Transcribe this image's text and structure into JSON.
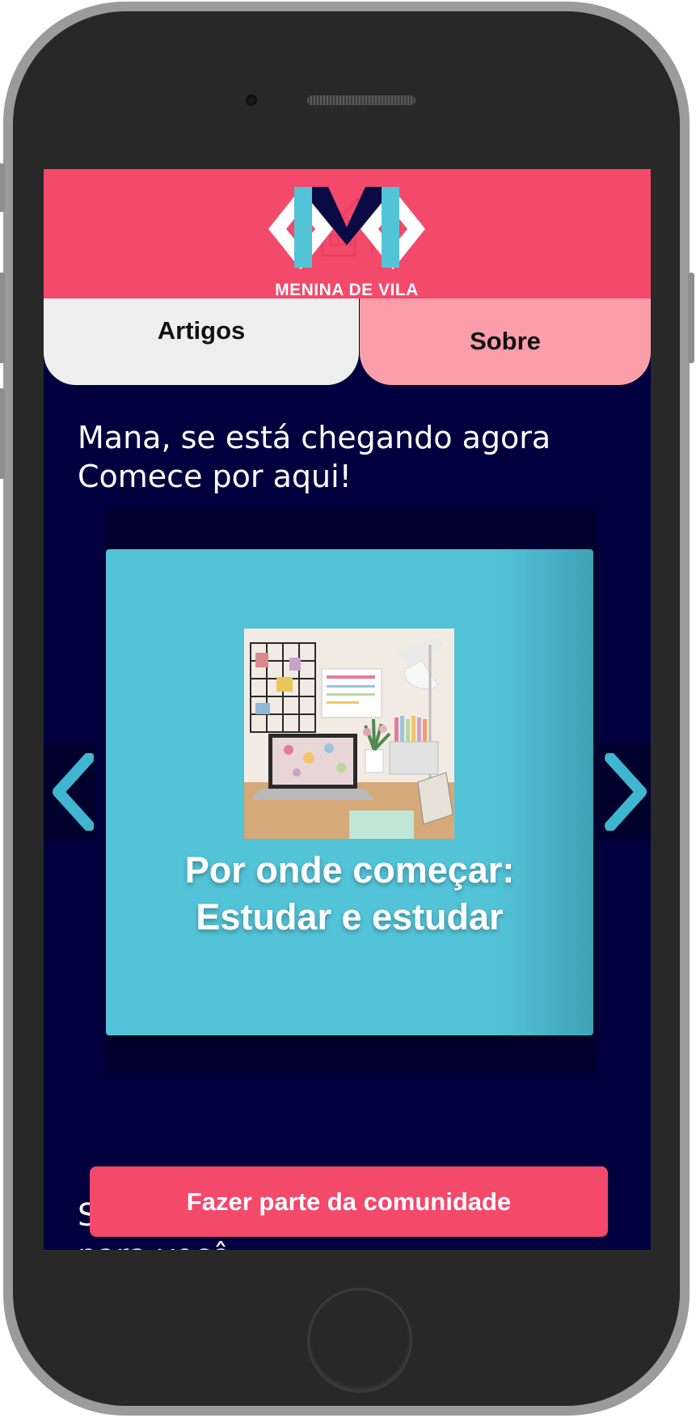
{
  "header": {
    "logo_text": "MENINA DE VILA",
    "background_color": "#f3496b"
  },
  "tabs": [
    {
      "label": "Artigos"
    },
    {
      "label": "Sobre"
    }
  ],
  "intro": {
    "line1": "Mana, se está chegando agora",
    "line2": "Comece por aqui!"
  },
  "carousel": {
    "prev_icon": "chevron-left-icon",
    "next_icon": "chevron-right-icon",
    "card": {
      "title_line1": "Por onde começar:",
      "title_line2": "Estudar e estudar",
      "image_description_icon": "desk-photo"
    }
  },
  "below_fold": {
    "line1_fragment": "S",
    "line2": "para você:"
  },
  "cta": {
    "label": "Fazer parte da comunidade"
  },
  "colors": {
    "page_background": "#00003f",
    "accent_pink": "#f3496b",
    "tab_light": "#eeeeee",
    "tab_pink": "#fb9ea9",
    "card_teal": "#53c3d8",
    "arrow_teal": "#3fb6cf"
  }
}
